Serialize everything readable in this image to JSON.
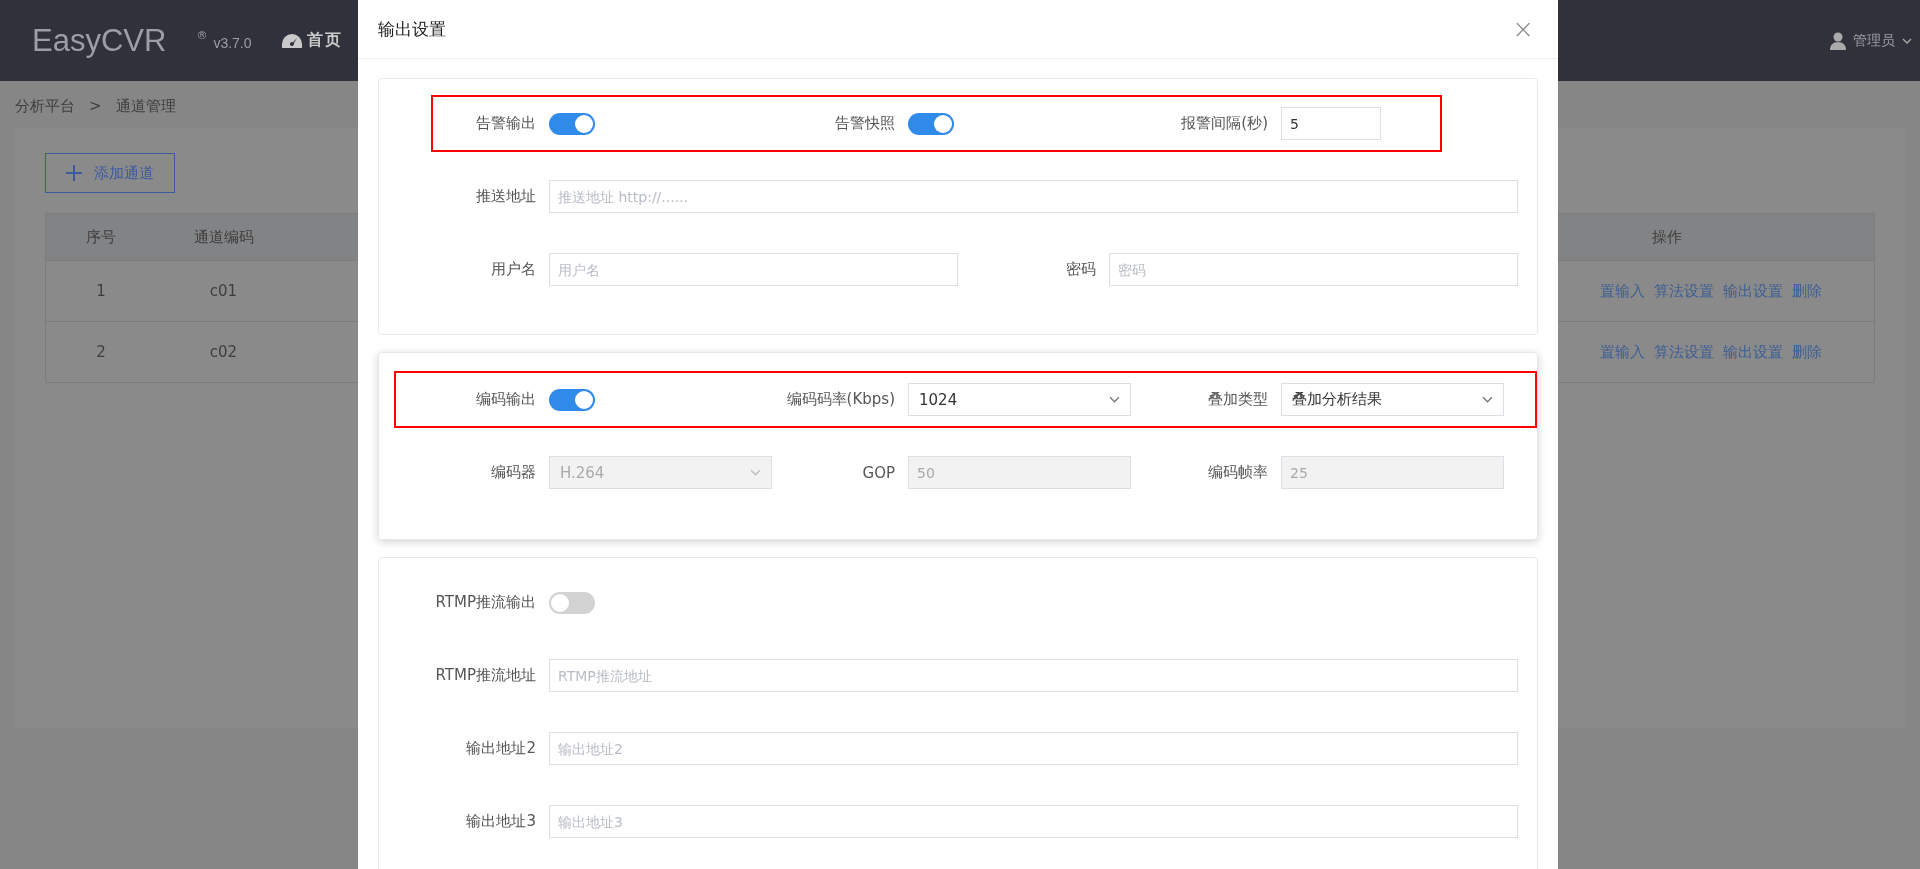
{
  "header": {
    "logo": "EasyCVR",
    "registered": "®",
    "version": "v3.7.0",
    "nav": "首页",
    "user": "管理员"
  },
  "breadcrumb": [
    "分析平台",
    ">",
    "通道管理"
  ],
  "add_button": "添加通道",
  "table": {
    "columns": [
      "序号",
      "通道编码",
      "操作"
    ],
    "rows": [
      {
        "cells": [
          "1",
          "c01"
        ],
        "actions": [
          "置输入",
          "算法设置",
          "输出设置",
          "删除"
        ]
      },
      {
        "cells": [
          "2",
          "c02"
        ],
        "actions": [
          "置输入",
          "算法设置",
          "输出设置",
          "删除"
        ]
      }
    ]
  },
  "dialog": {
    "title": "输出设置",
    "close": "×",
    "sections": [
      {
        "raised": false,
        "rows": [
          {
            "kind": "three",
            "highlighted": true,
            "fields": [
              {
                "kind": "switch",
                "label": "告警输出",
                "on": true
              },
              {
                "kind": "switch",
                "label": "告警快照",
                "on": true
              },
              {
                "kind": "short-input",
                "label": "报警间隔(秒)",
                "value": "5",
                "disabled": false
              }
            ]
          },
          {
            "kind": "one",
            "highlighted": false,
            "fields": [
              {
                "kind": "input",
                "label": "推送地址",
                "placeholder": "推送地址 http://......",
                "disabled": false
              }
            ]
          },
          {
            "kind": "two",
            "highlighted": false,
            "fields": [
              {
                "kind": "input",
                "label": "用户名",
                "placeholder": "用户名",
                "disabled": false
              },
              {
                "kind": "input",
                "label": "密码",
                "placeholder": "密码",
                "disabled": false
              }
            ]
          }
        ]
      },
      {
        "raised": true,
        "rows": [
          {
            "kind": "three",
            "highlighted": true,
            "fields": [
              {
                "kind": "switch",
                "label": "编码输出",
                "on": true
              },
              {
                "kind": "select",
                "label": "编码码率(Kbps)",
                "value": "1024",
                "disabled": false
              },
              {
                "kind": "select",
                "label": "叠加类型",
                "value": "叠加分析结果",
                "disabled": false
              }
            ]
          },
          {
            "kind": "three",
            "highlighted": false,
            "fields": [
              {
                "kind": "select",
                "label": "编码器",
                "value": "H.264",
                "disabled": true
              },
              {
                "kind": "input",
                "label": "GOP",
                "value": "50",
                "disabled": true
              },
              {
                "kind": "input",
                "label": "编码帧率",
                "value": "25",
                "disabled": true
              }
            ]
          }
        ]
      },
      {
        "raised": false,
        "rows": [
          {
            "kind": "one",
            "highlighted": false,
            "fields": [
              {
                "kind": "switch",
                "label": "RTMP推流输出",
                "on": false
              }
            ]
          },
          {
            "kind": "one",
            "highlighted": false,
            "fields": [
              {
                "kind": "input",
                "label": "RTMP推流地址",
                "placeholder": "RTMP推流地址",
                "disabled": false
              }
            ]
          },
          {
            "kind": "one",
            "highlighted": false,
            "fields": [
              {
                "kind": "input",
                "label": "输出地址2",
                "placeholder": "输出地址2",
                "disabled": false
              }
            ]
          },
          {
            "kind": "one",
            "highlighted": false,
            "fields": [
              {
                "kind": "input",
                "label": "输出地址3",
                "placeholder": "输出地址3",
                "disabled": false
              }
            ]
          }
        ]
      }
    ]
  }
}
